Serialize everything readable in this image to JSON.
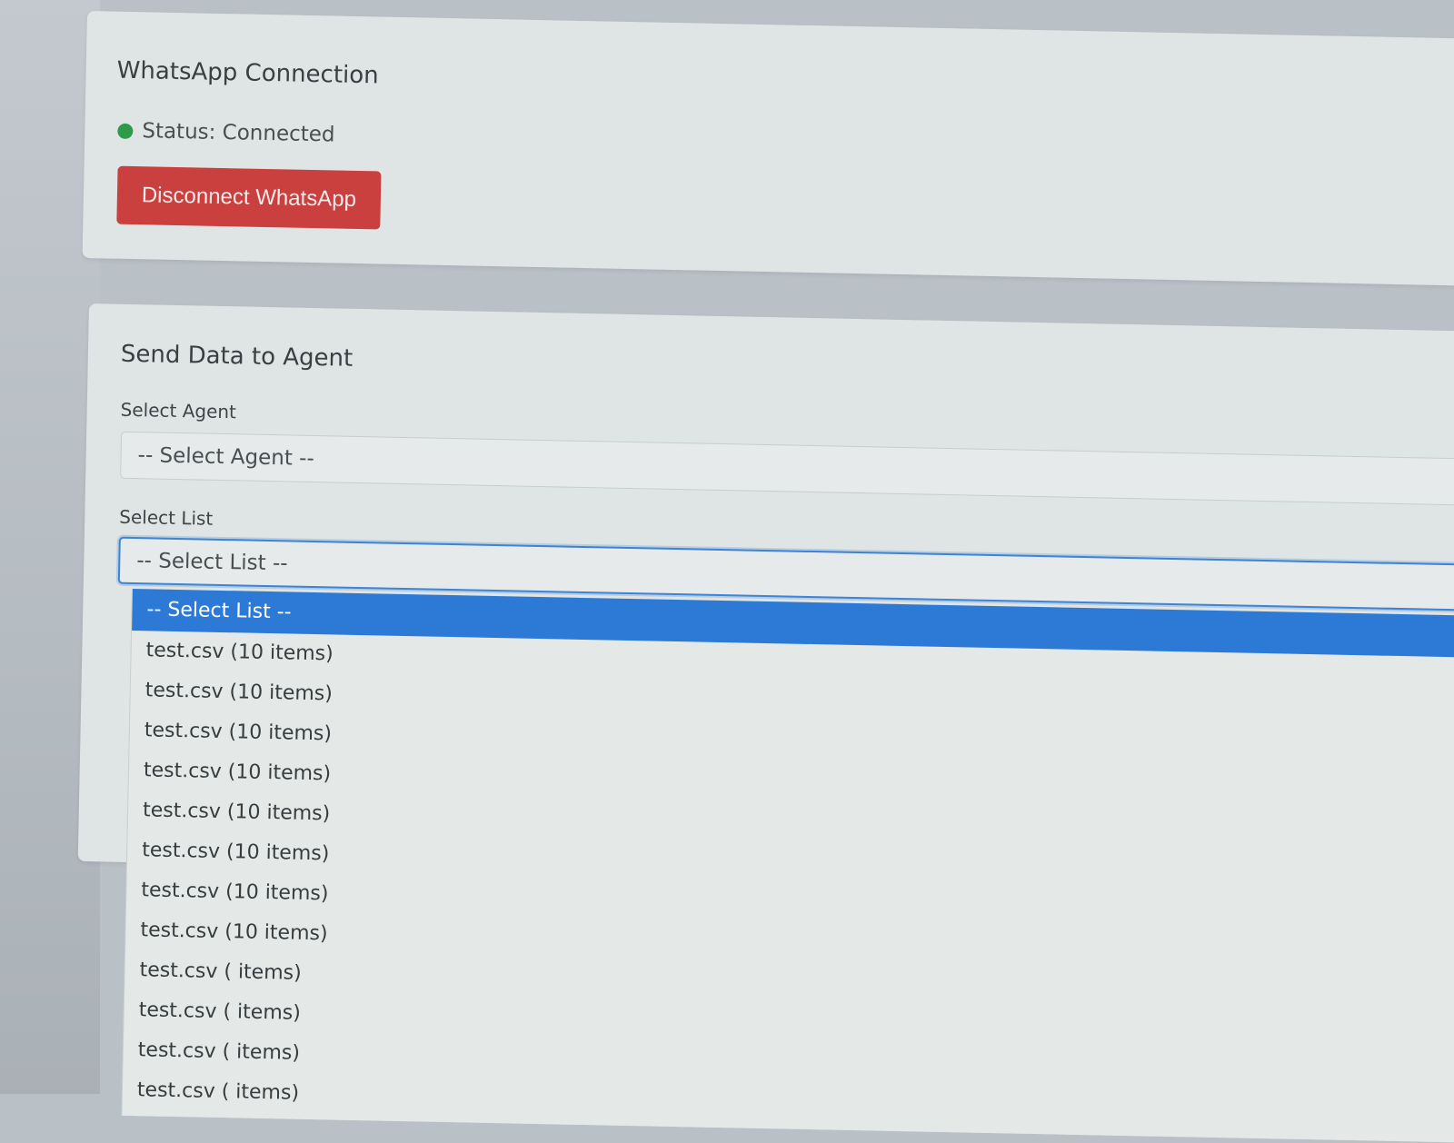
{
  "whatsapp_card": {
    "title": "WhatsApp Connection",
    "status_text": "Status: Connected",
    "status_color": "#2f9a4a",
    "disconnect_label": "Disconnect WhatsApp",
    "button_color": "#c9403f"
  },
  "send_card": {
    "title": "Send Data to Agent",
    "agent_label": "Select Agent",
    "agent_value": "-- Select Agent --",
    "list_label": "Select List",
    "list_value": "-- Select List --"
  },
  "list_dropdown": {
    "options": [
      "-- Select List --",
      "test.csv (10 items)",
      "test.csv (10 items)",
      "test.csv (10 items)",
      "test.csv (10 items)",
      "test.csv (10 items)",
      "test.csv (10 items)",
      "test.csv (10 items)",
      "test.csv (10 items)",
      "test.csv ( items)",
      "test.csv ( items)",
      "test.csv ( items)",
      "test.csv ( items)"
    ],
    "selected_index": 0,
    "highlight_color": "#2c7ad6"
  }
}
